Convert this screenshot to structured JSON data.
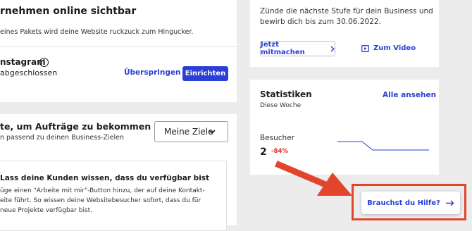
{
  "visible_card": {
    "title": "rnehmen online sichtbar",
    "subtitle": "eines Pakets wird deine Website ruckzuck zum Hingucker.",
    "step_title": "nstagram",
    "step_status": "abgeschlossen",
    "skip_label": "Überspringen",
    "setup_label": "Einrichten"
  },
  "goals_card": {
    "title": "te, um Aufträge zu bekommen",
    "subtitle": "n passend zu deinen Business-Zielen",
    "select_value": "Meine Ziele",
    "tip_title": "Lass deine Kunden wissen, dass du verfügbar bist",
    "tip_lines": [
      "üge einen \"Arbeite mit mir\"-Button hinzu, der auf deine Kontakt-",
      "eite führt. So wissen deine Websitebesucher sofort, dass du für",
      "neue Projekte verfügbar bist."
    ]
  },
  "promo_card": {
    "text_line1": "Zünde die nächste Stufe für dein Business und",
    "text_line2": "bewirb dich bis zum 30.06.2022.",
    "join_label": "Jetzt mitmachen",
    "video_label": "Zum Video"
  },
  "stats_card": {
    "title": "Statistiken",
    "period": "Diese Woche",
    "view_all": "Alle ansehen",
    "metric_label": "Besucher",
    "metric_value": "2",
    "metric_change": "-84%",
    "accent_color": "#2a3fd6",
    "negative_color": "#d9342b"
  },
  "help": {
    "label": "Brauchst du Hilfe?"
  }
}
